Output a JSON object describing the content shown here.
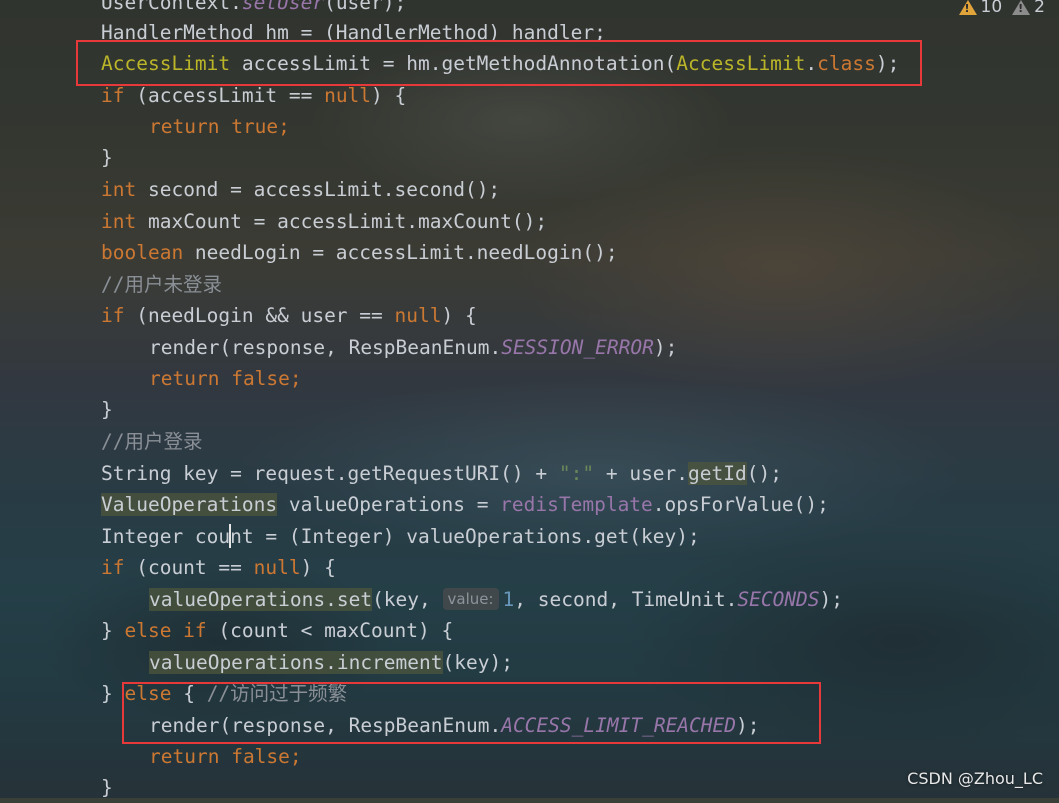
{
  "inspections": {
    "warnings": "10",
    "weak_warnings": "2"
  },
  "code": {
    "l0": {
      "a": "UserContext.",
      "b": "setUser",
      "c": "(user);"
    },
    "l1": {
      "a": "HandlerMethod hm = (HandlerMethod) handler;"
    },
    "l2": {
      "a": "AccessLimit",
      "b": " accessLimit = hm.getMethodAnnotation(",
      "c": "AccessLimit",
      "d": ".",
      "e": "class",
      "f": ");"
    },
    "l3": {
      "a": "if",
      "b": " (accessLimit == ",
      "c": "null",
      "d": ") {"
    },
    "l4": {
      "a": "return",
      "b": " ",
      "c": "true",
      "d": ";"
    },
    "l5": {
      "a": "}"
    },
    "l6": {
      "a": "int",
      "b": " second = accessLimit.second();"
    },
    "l7": {
      "a": "int",
      "b": " maxCount = accessLimit.maxCount();"
    },
    "l8": {
      "a": "boolean",
      "b": " needLogin = accessLimit.needLogin();"
    },
    "l9": {
      "a": "//用户未登录"
    },
    "l10": {
      "a": "if",
      "b": " (needLogin && user == ",
      "c": "null",
      "d": ") {"
    },
    "l11": {
      "a": "render(response, RespBeanEnum.",
      "b": "SESSION_ERROR",
      "c": ");"
    },
    "l12": {
      "a": "return",
      "b": " ",
      "c": "false",
      "d": ";"
    },
    "l13": {
      "a": "}"
    },
    "l14": {
      "a": "//用户登录"
    },
    "l15": {
      "a": "String key = request.getRequestURI() + ",
      "b": "\":\"",
      "c": " + user.",
      "d": "getId",
      "e": "();"
    },
    "l16": {
      "a": "ValueOperations",
      "b": " valueOperations = ",
      "c": "redisTemplate",
      "d": ".opsForValue();"
    },
    "l17": {
      "a": "Integer cou",
      "b": "nt = (Integer) valueOperations.get(key);"
    },
    "l18": {
      "a": "if",
      "b": " (count == ",
      "c": "null",
      "d": ") {"
    },
    "l19": {
      "a": "valueOperations.set",
      "b": "(key, ",
      "hint": "value:",
      "c": "1",
      "d": ", second, TimeUnit.",
      "e": "SECONDS",
      "f": ");"
    },
    "l20": {
      "a": "} ",
      "b": "else if",
      "c": " (count < maxCount) {"
    },
    "l21": {
      "a": "valueOperations.increment",
      "b": "(key);"
    },
    "l22": {
      "a": "} ",
      "b": "else",
      "c": " { ",
      "d": "//访问过于频繁"
    },
    "l23": {
      "a": "render(response, RespBeanEnum.",
      "b": "ACCESS_LIMIT_REACHED",
      "c": ");"
    },
    "l24": {
      "a": "return",
      "b": " ",
      "c": "false",
      "d": ";"
    },
    "l25": {
      "a": "}"
    }
  },
  "watermark": "CSDN @Zhou_LC",
  "colors": {
    "highlight_box": "#e8393a",
    "keyword": "#cc7832",
    "annotation": "#bbb529",
    "constant": "#9876aa"
  }
}
